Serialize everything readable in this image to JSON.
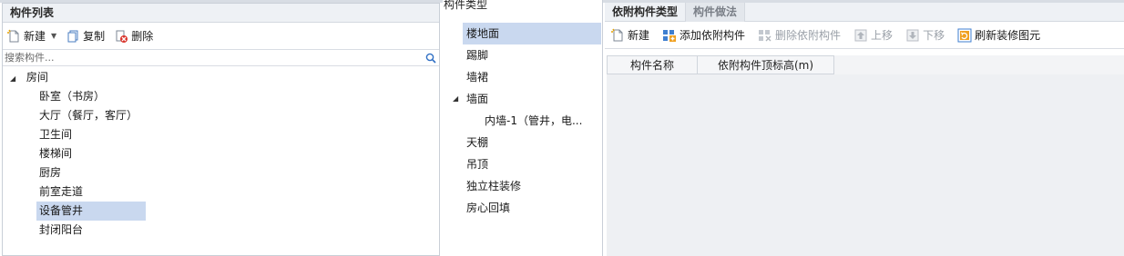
{
  "left": {
    "title": "构件列表",
    "toolbar": {
      "new_label": "新建",
      "copy_label": "复制",
      "delete_label": "删除"
    },
    "search_placeholder": "搜索构件...",
    "tree": {
      "root_label": "房间",
      "children": [
        "卧室（书房）",
        "大厅（餐厅，客厅）",
        "卫生间",
        "楼梯间",
        "厨房",
        "前室走道",
        "设备管井",
        "封闭阳台"
      ],
      "selected_index": 6
    }
  },
  "middle": {
    "title": "构件类型",
    "items": [
      {
        "label": "楼地面",
        "selected": true
      },
      {
        "label": "踢脚"
      },
      {
        "label": "墙裙"
      },
      {
        "label": "墙面",
        "expanded": true
      },
      {
        "label": "内墙-1（管井，电..."
      },
      {
        "label": "天棚"
      },
      {
        "label": "吊顶"
      },
      {
        "label": "独立柱装修"
      },
      {
        "label": "房心回填"
      }
    ]
  },
  "right": {
    "tabs": [
      "依附构件类型",
      "构件做法"
    ],
    "active_tab": 0,
    "toolbar": {
      "new_label": "新建",
      "add_label": "添加依附构件",
      "delete_label": "删除依附构件",
      "up_label": "上移",
      "down_label": "下移",
      "refresh_label": "刷新装修图元"
    },
    "grid": {
      "columns": [
        "构件名称",
        "依附构件顶标高(m)"
      ]
    }
  },
  "colors": {
    "selection": "#c9d8ef",
    "header_bg": "#eef1f5",
    "border": "#c9cfd7",
    "disabled_text": "#9aa0a8"
  }
}
